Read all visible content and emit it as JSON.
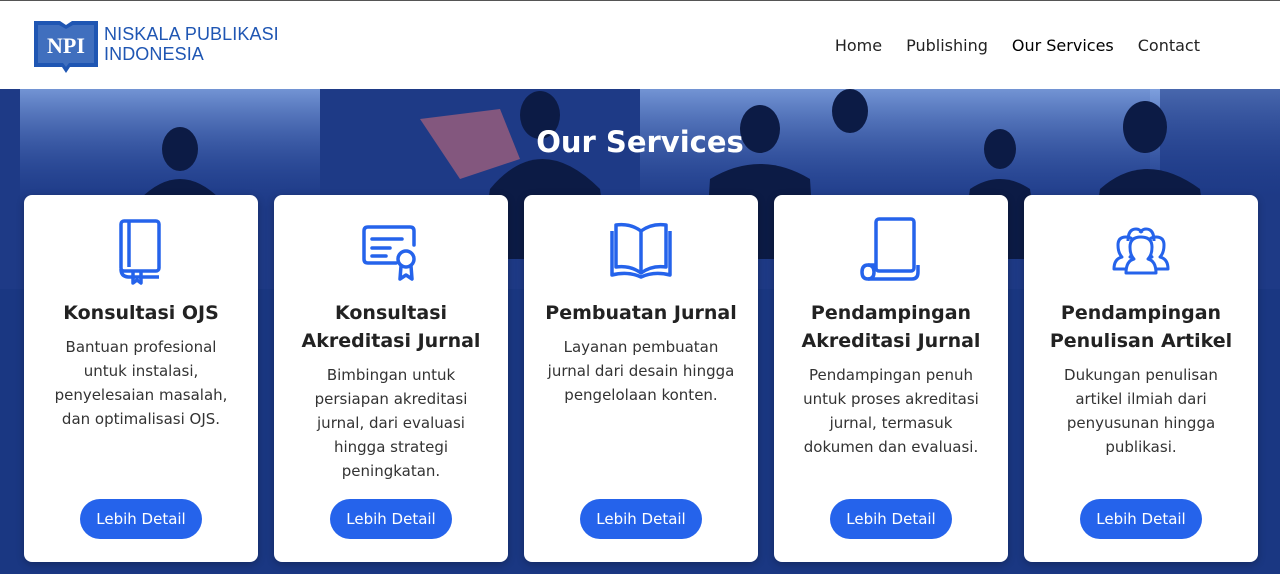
{
  "brand": {
    "mark_text": "NPI",
    "line1": "NISKALA PUBLIKASI",
    "line2": "INDONESIA",
    "color": "#1f56b3"
  },
  "nav": {
    "items": [
      {
        "label": "Home"
      },
      {
        "label": "Publishing"
      },
      {
        "label": "Our Services"
      },
      {
        "label": "Contact"
      }
    ],
    "active": "Our Services"
  },
  "services": {
    "title": "Our Services",
    "accent": "#2563eb",
    "cards": [
      {
        "icon": "book-icon",
        "title": "Konsultasi OJS",
        "description": "Bantuan profesional untuk instalasi, penyelesaian masalah, dan optimalisasi OJS.",
        "button": "Lebih Detail"
      },
      {
        "icon": "certificate-icon",
        "title": "Konsultasi Akreditasi Jurnal",
        "description": "Bimbingan untuk persiapan akreditasi jurnal, dari evaluasi hingga strategi peningkatan.",
        "button": "Lebih Detail"
      },
      {
        "icon": "open-book-icon",
        "title": "Pembuatan Jurnal",
        "description": "Layanan pembuatan jurnal dari desain hingga pengelolaan konten.",
        "button": "Lebih Detail"
      },
      {
        "icon": "scroll-icon",
        "title": "Pendampingan Akreditasi Jurnal",
        "description": "Pendampingan penuh untuk proses akreditasi jurnal, termasuk dokumen dan evaluasi.",
        "button": "Lebih Detail"
      },
      {
        "icon": "users-icon",
        "title": "Pendampingan Penulisan Artikel",
        "description": "Dukungan penulisan artikel ilmiah dari penyusunan hingga publikasi.",
        "button": "Lebih Detail"
      }
    ]
  }
}
